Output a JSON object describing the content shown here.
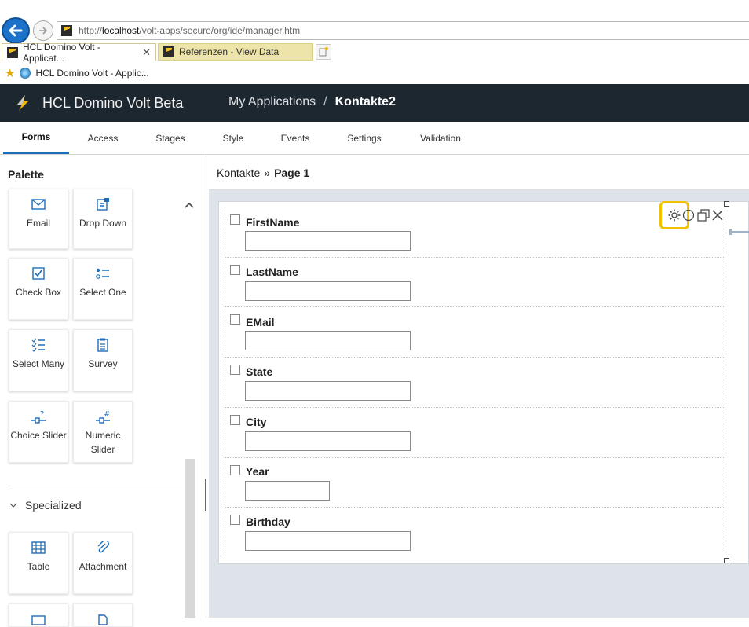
{
  "browser": {
    "url_prefix": "http://",
    "url_host": "localhost",
    "url_path": "/volt-apps/secure/org/ide/manager.html",
    "tabs": [
      {
        "label": "HCL Domino Volt - Applicat...",
        "close": "✕"
      },
      {
        "label": "Referenzen - View Data"
      }
    ],
    "favorite": "HCL Domino Volt - Applic..."
  },
  "header": {
    "app_title": "HCL Domino Volt Beta",
    "breadcrumb_root": "My Applications",
    "breadcrumb_sep": "/",
    "breadcrumb_current": "Kontakte2"
  },
  "nav_tabs": [
    "Forms",
    "Access",
    "Stages",
    "Style",
    "Events",
    "Settings",
    "Validation"
  ],
  "palette": {
    "title": "Palette",
    "items": [
      {
        "label": "Email",
        "icon": "email-icon"
      },
      {
        "label": "Drop Down",
        "icon": "dropdown-icon"
      },
      {
        "label": "Check Box",
        "icon": "checkbox-icon"
      },
      {
        "label": "Select One",
        "icon": "select-one-icon"
      },
      {
        "label": "Select Many",
        "icon": "select-many-icon"
      },
      {
        "label": "Survey",
        "icon": "survey-icon"
      },
      {
        "label": "Choice Slider",
        "icon": "choice-slider-icon"
      },
      {
        "label": "Numeric Slider",
        "icon": "numeric-slider-icon"
      },
      {
        "label": "Table",
        "icon": "table-icon"
      },
      {
        "label": "Attachment",
        "icon": "attachment-icon"
      }
    ],
    "section_specialized": "Specialized"
  },
  "canvas": {
    "form_name": "Kontakte",
    "sep": "»",
    "page": "Page 1",
    "fields": [
      {
        "label": "FirstName"
      },
      {
        "label": "LastName"
      },
      {
        "label": "EMail"
      },
      {
        "label": "State"
      },
      {
        "label": "City"
      },
      {
        "label": "Year"
      },
      {
        "label": "Birthday"
      }
    ]
  },
  "colors": {
    "header_bg": "#1d2730",
    "accent": "#1e6db8",
    "highlight": "#f2c200"
  }
}
